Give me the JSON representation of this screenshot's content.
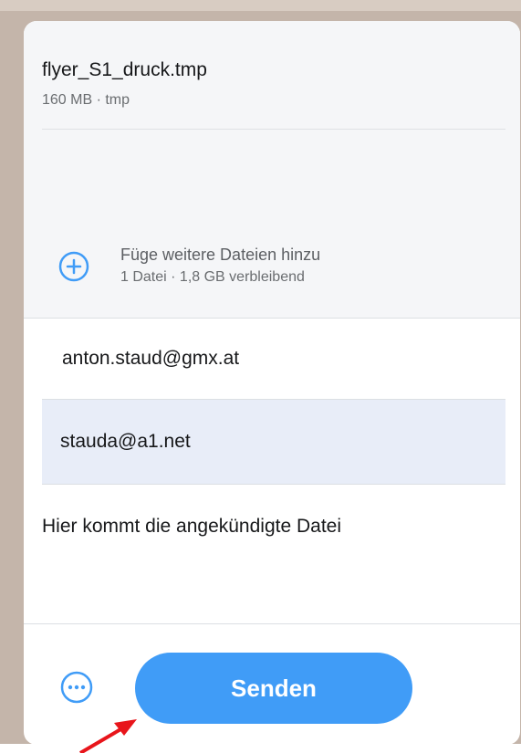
{
  "file": {
    "name": "flyer_S1_druck.tmp",
    "meta": "160 MB · tmp"
  },
  "add_files": {
    "title": "Füge weitere Dateien hinzu",
    "subtitle": "1 Datei · 1,8 GB verbleibend"
  },
  "form": {
    "email_to": "anton.staud@gmx.at",
    "email_from": "stauda@a1.net",
    "message": "Hier kommt die angekündigte Datei"
  },
  "actions": {
    "more_icon": "ellipsis-circle-icon",
    "send_label": "Senden"
  },
  "icons": {
    "check": "check-icon",
    "add": "plus-circle-icon",
    "annotation": "red-arrow"
  },
  "colors": {
    "accent": "#409cf7",
    "selected_field_bg": "#e8edf8",
    "annotation_red": "#e8151b"
  }
}
